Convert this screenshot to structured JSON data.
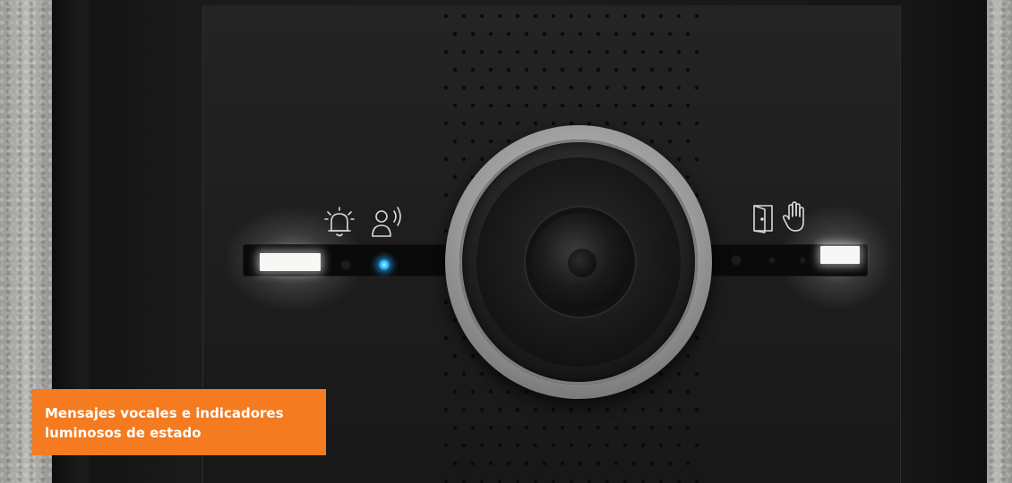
{
  "caption": {
    "line1": "Mensajes vocales e indicadores",
    "line2": "luminosos de estado"
  },
  "indicator_symbols": [
    "bell-ringing-icon",
    "person-speaking-icon",
    "door-open-icon",
    "hand-stop-icon"
  ],
  "colors": {
    "caption_background": "#f47b1f",
    "status_led_active": "#2fb8ff",
    "panel": "#1f1f1f"
  }
}
